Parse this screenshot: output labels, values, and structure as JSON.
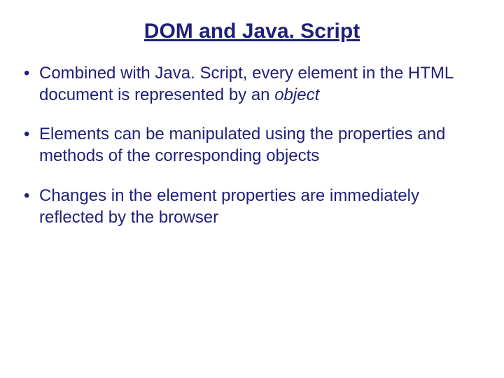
{
  "title": "DOM and Java. Script",
  "bullets": [
    {
      "pre": "Combined with Java. Script, every element in the HTML document is represented by an ",
      "em": "object",
      "post": ""
    },
    {
      "pre": "Elements can be manipulated using the properties and methods of the corresponding objects",
      "em": "",
      "post": ""
    },
    {
      "pre": "Changes in the element properties are immediately reflected by the browser",
      "em": "",
      "post": ""
    }
  ]
}
